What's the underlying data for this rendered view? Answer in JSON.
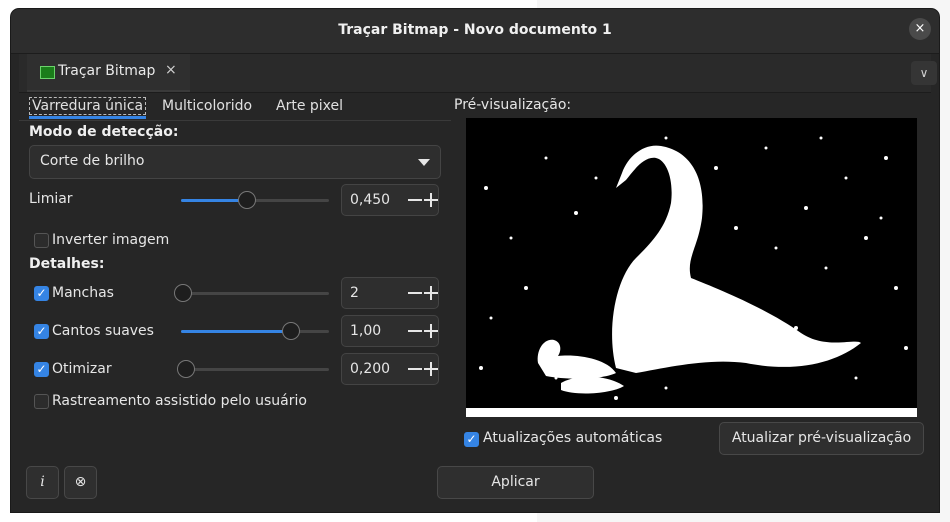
{
  "window": {
    "title": "Traçar Bitmap - Novo documento 1",
    "close_icon": "×"
  },
  "dock": {
    "tab_label": "Traçar Bitmap",
    "tab_close": "×",
    "menu_icon": "∨"
  },
  "mode_tabs": [
    "Varredura única",
    "Multicolorido",
    "Arte pixel"
  ],
  "detection": {
    "label": "Modo de detecção:",
    "selected": "Corte de brilho"
  },
  "threshold": {
    "label": "Limiar",
    "value": "0,450",
    "slider_fraction": 0.45
  },
  "invert": {
    "label": "Inverter imagem",
    "checked": false
  },
  "details": {
    "label": "Detalhes:",
    "speckles": {
      "label": "Manchas",
      "checked": true,
      "value": "2",
      "slider_fraction": 0.0
    },
    "smooth": {
      "label": "Cantos suaves",
      "checked": true,
      "value": "1,00",
      "slider_fraction": 0.75
    },
    "optimize": {
      "label": "Otimizar",
      "checked": true,
      "value": "0,200",
      "slider_fraction": 0.0
    }
  },
  "assisted": {
    "label": "Rastreamento assistido pelo usuário",
    "checked": false
  },
  "preview": {
    "label": "Pré-visualização:",
    "auto_update_label": "Atualizações automáticas",
    "auto_update_checked": true,
    "update_button": "Atualizar pré-visualização"
  },
  "bottom": {
    "info_icon": "i",
    "stop_icon": "⊗",
    "apply_button": "Aplicar"
  }
}
